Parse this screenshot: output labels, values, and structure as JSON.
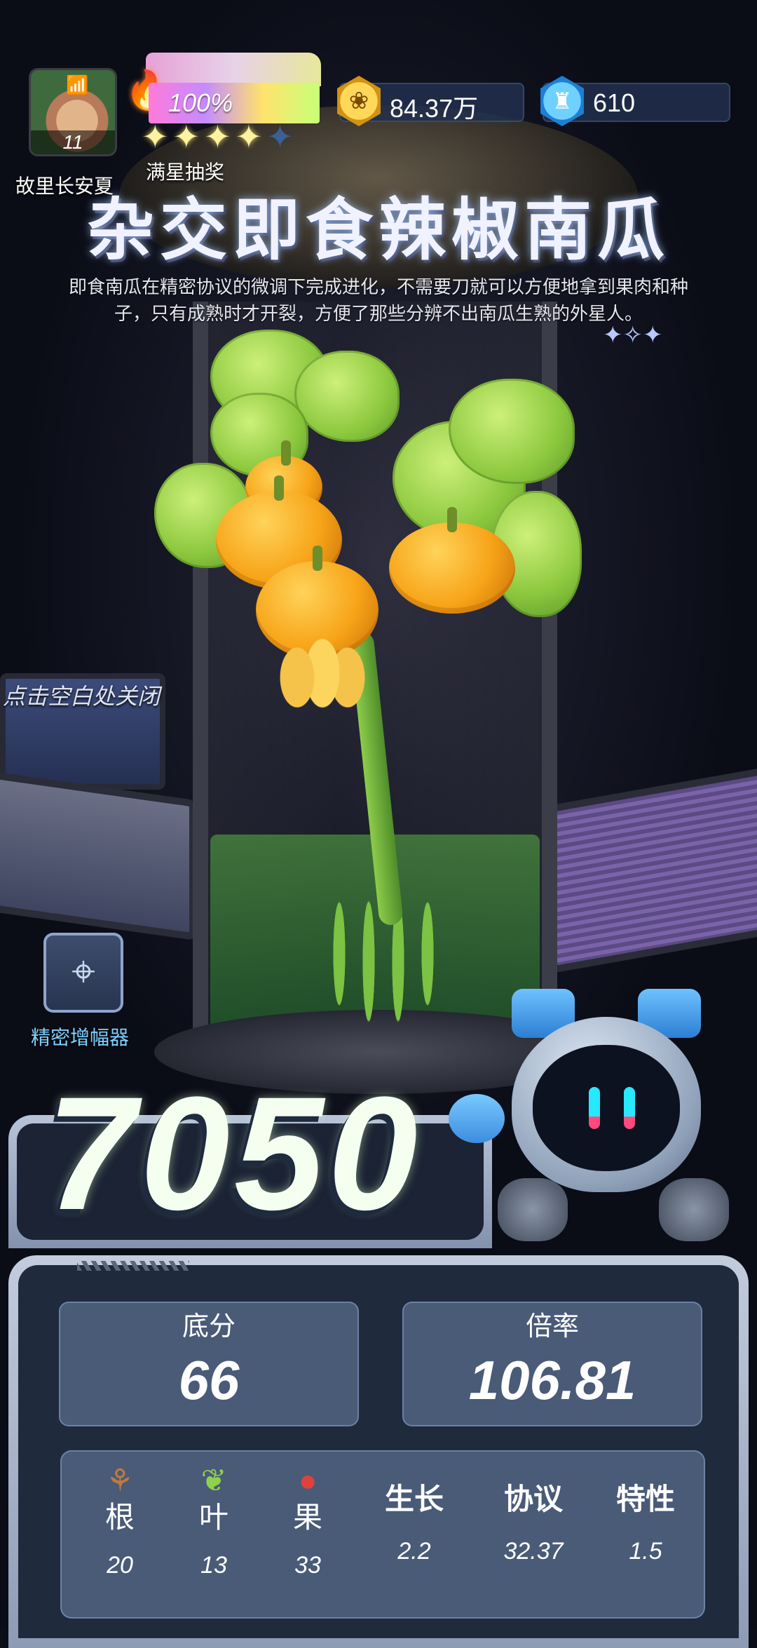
{
  "player": {
    "level": "11",
    "name": "故里长安夏"
  },
  "star_progress": {
    "percent_label": "100%",
    "percent_value": 100,
    "stars_filled": 4,
    "stars_total": 5,
    "label": "满星抽奖"
  },
  "currencies": {
    "coins": "84.37万",
    "gems": "610"
  },
  "plant": {
    "title": "杂交即食辣椒南瓜",
    "description": "即食南瓜在精密协议的微调下完成进化，不需要刀就可以方便地拿到果肉和种子，只有成熟时才开裂，方便了那些分辨不出南瓜生熟的外星人。"
  },
  "close_hint": "点击空白处关闭",
  "amplifier": {
    "label": "精密增幅器"
  },
  "score": "7050",
  "stats": {
    "base": {
      "label": "底分",
      "value": "66"
    },
    "multiplier": {
      "label": "倍率",
      "value": "106.81"
    }
  },
  "attributes": [
    {
      "label": "根",
      "value": "20",
      "icon": "root-icon"
    },
    {
      "label": "叶",
      "value": "13",
      "icon": "leaf-icon"
    },
    {
      "label": "果",
      "value": "33",
      "icon": "fruit-icon"
    },
    {
      "label": "生长",
      "value": "2.2"
    },
    {
      "label": "协议",
      "value": "32.37"
    },
    {
      "label": "特性",
      "value": "1.5"
    }
  ],
  "colors": {
    "accent_blue": "#7fd0ff",
    "panel": "#4a5b78",
    "pumpkin": "#f7a418"
  }
}
